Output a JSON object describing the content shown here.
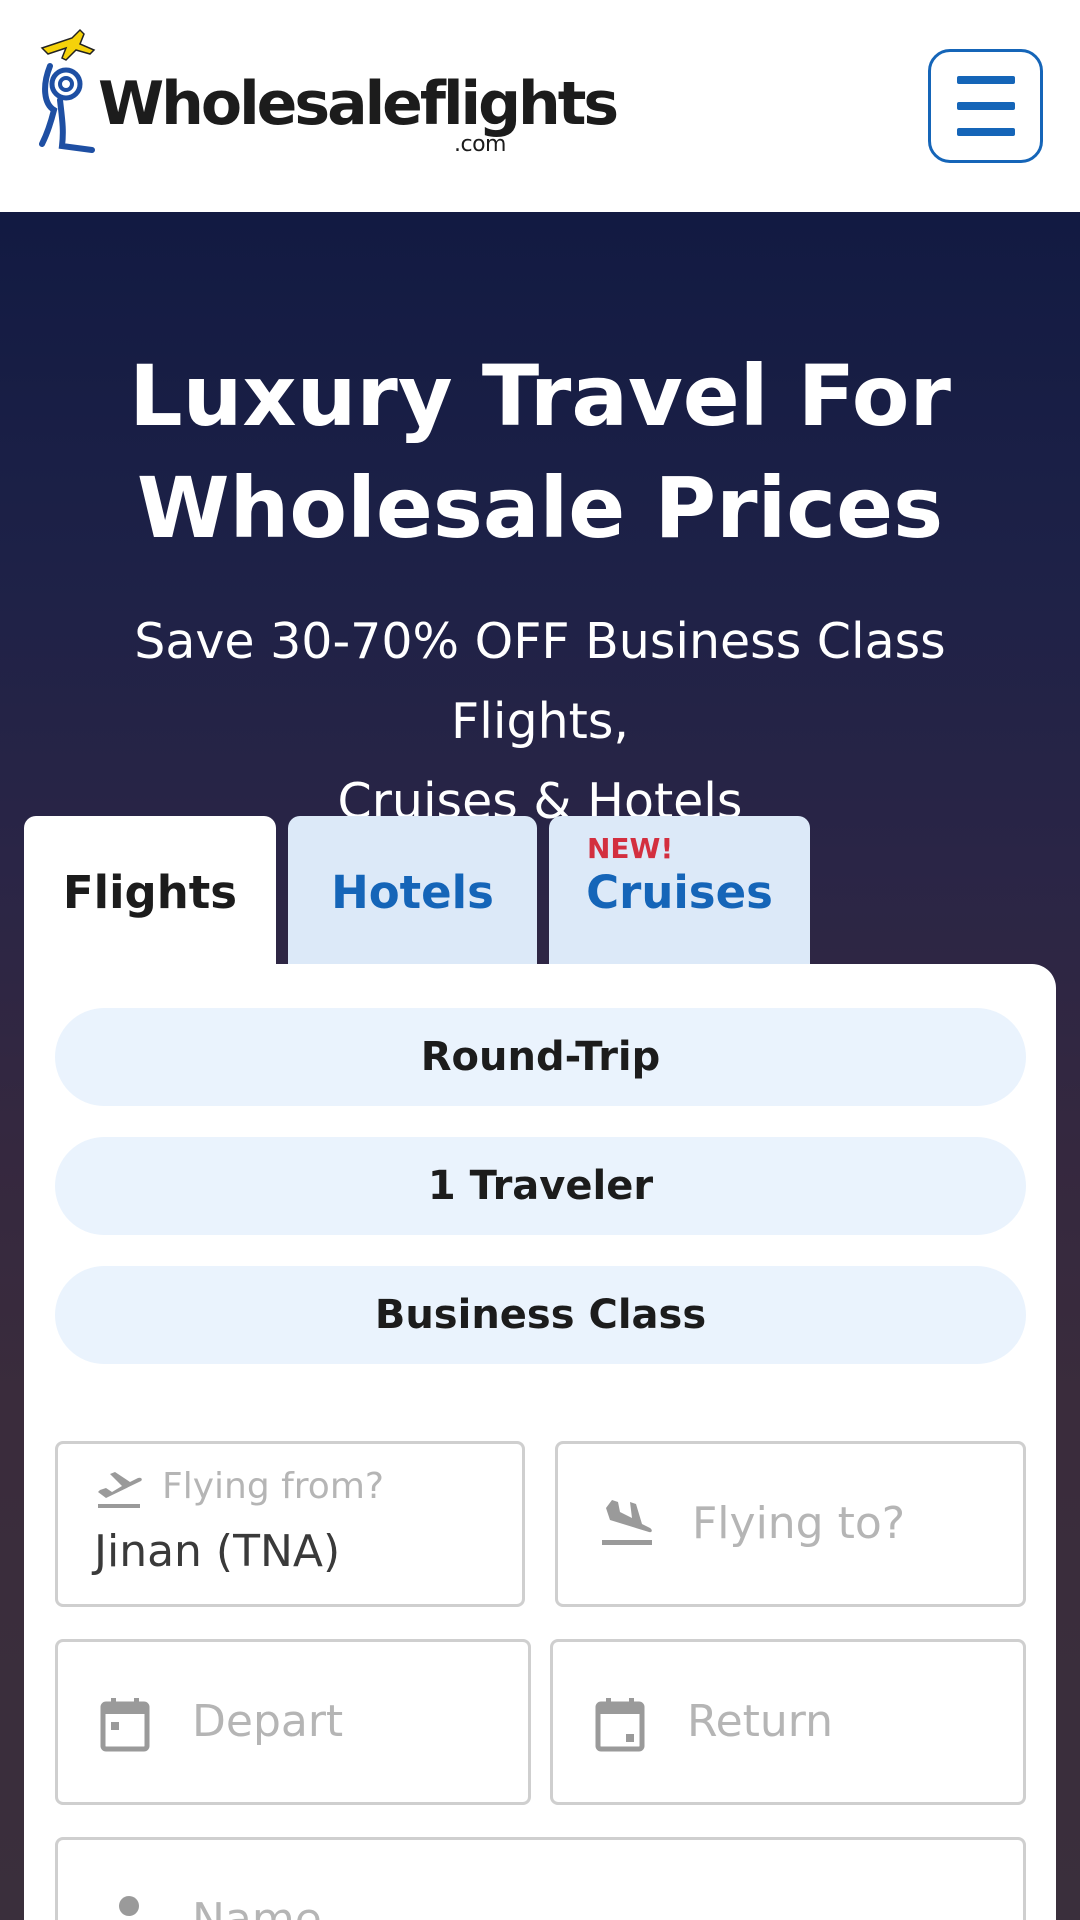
{
  "header": {
    "logo_text": "Wholesaleflights",
    "logo_suffix": ".com",
    "menu_icon": "hamburger-menu-icon",
    "brand_color": "#1565b8"
  },
  "hero": {
    "title_line1": "Luxury Travel For",
    "title_line2": "Wholesale Prices",
    "subtitle_line1": "Save 30-70% OFF Business Class Flights,",
    "subtitle_line2": "Cruises & Hotels"
  },
  "tabs": [
    {
      "label": "Flights",
      "active": true
    },
    {
      "label": "Hotels",
      "active": false
    },
    {
      "label": "Cruises",
      "active": false,
      "badge": "NEW!"
    }
  ],
  "search": {
    "trip_type": "Round-Trip",
    "travelers": "1 Traveler",
    "cabin_class": "Business Class",
    "from": {
      "label": "Flying from?",
      "value": "Jinan (TNA)",
      "icon": "takeoff-icon"
    },
    "to": {
      "placeholder": "Flying to?",
      "icon": "landing-icon"
    },
    "depart": {
      "placeholder": "Depart",
      "icon": "calendar-icon"
    },
    "return": {
      "placeholder": "Return",
      "icon": "calendar-icon"
    },
    "name": {
      "placeholder": "Name",
      "icon": "person-icon"
    }
  }
}
